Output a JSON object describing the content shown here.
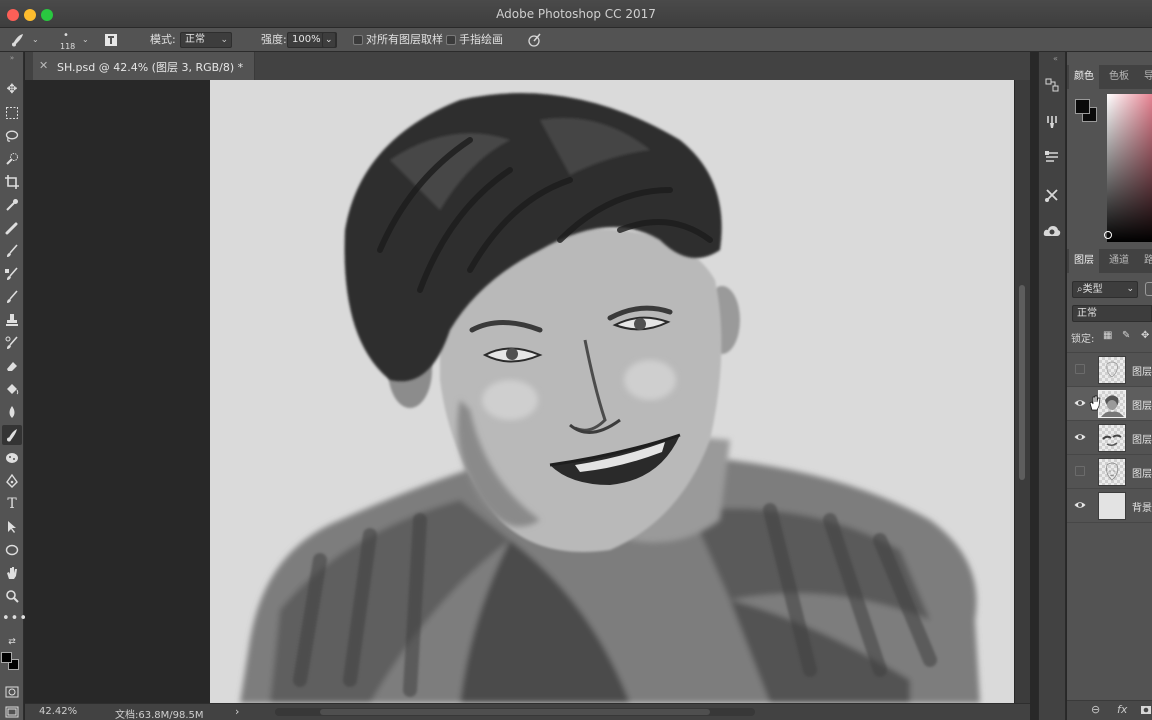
{
  "window": {
    "title": "Adobe Photoshop CC 2017"
  },
  "options_bar": {
    "brush_size": "118",
    "mode_label": "模式:",
    "mode_value": "正常",
    "strength_label": "强度:",
    "strength_value": "100%",
    "sample_all_layers_label": "对所有图层取样",
    "sample_all_layers_checked": false,
    "finger_painting_label": "手指绘画",
    "finger_painting_checked": false
  },
  "toolbar": {
    "tools": [
      "move-tool",
      "marquee-tool",
      "lasso-tool",
      "quick-selection-tool",
      "crop-tool",
      "eyedropper-tool",
      "healing-brush-tool",
      "brush-tool",
      "clone-stamp-tool",
      "history-brush-tool",
      "eraser-tool",
      "gradient-tool",
      "blur-tool",
      "smudge-tool",
      "dodge-tool",
      "pen-tool",
      "type-tool",
      "path-selection-tool",
      "ellipse-tool",
      "hand-tool",
      "zoom-tool",
      "more-tools"
    ],
    "active_tool": "smudge-tool",
    "foreground_color": "#000000",
    "background_color": "#000000"
  },
  "document": {
    "tab_title": "SH.psd @ 42.4% (图层 3, RGB/8) *",
    "zoom": "42.42%",
    "doc_size": "文档:63.8M/98.5M"
  },
  "panels": {
    "color_tabs": [
      "颜色",
      "色板",
      "导"
    ],
    "active_color_tab": "颜色",
    "layers_tabs": [
      "图层",
      "通道",
      "路"
    ],
    "active_layers_tab": "图层",
    "filter_label": "类型",
    "blend_mode": "正常",
    "lock_label": "锁定:",
    "layers": [
      {
        "name": "图层",
        "visible": false,
        "selected": false
      },
      {
        "name": "图层",
        "visible": true,
        "selected": true
      },
      {
        "name": "图层",
        "visible": true,
        "selected": false
      },
      {
        "name": "图层",
        "visible": false,
        "selected": false
      },
      {
        "name": "背景",
        "visible": true,
        "selected": false
      }
    ],
    "footer_link": "⊖",
    "footer_fx": "fx"
  },
  "colors": {
    "accent_foreground": "#000000",
    "canvas_bg": "#dadada",
    "panel_bg": "#535353"
  }
}
